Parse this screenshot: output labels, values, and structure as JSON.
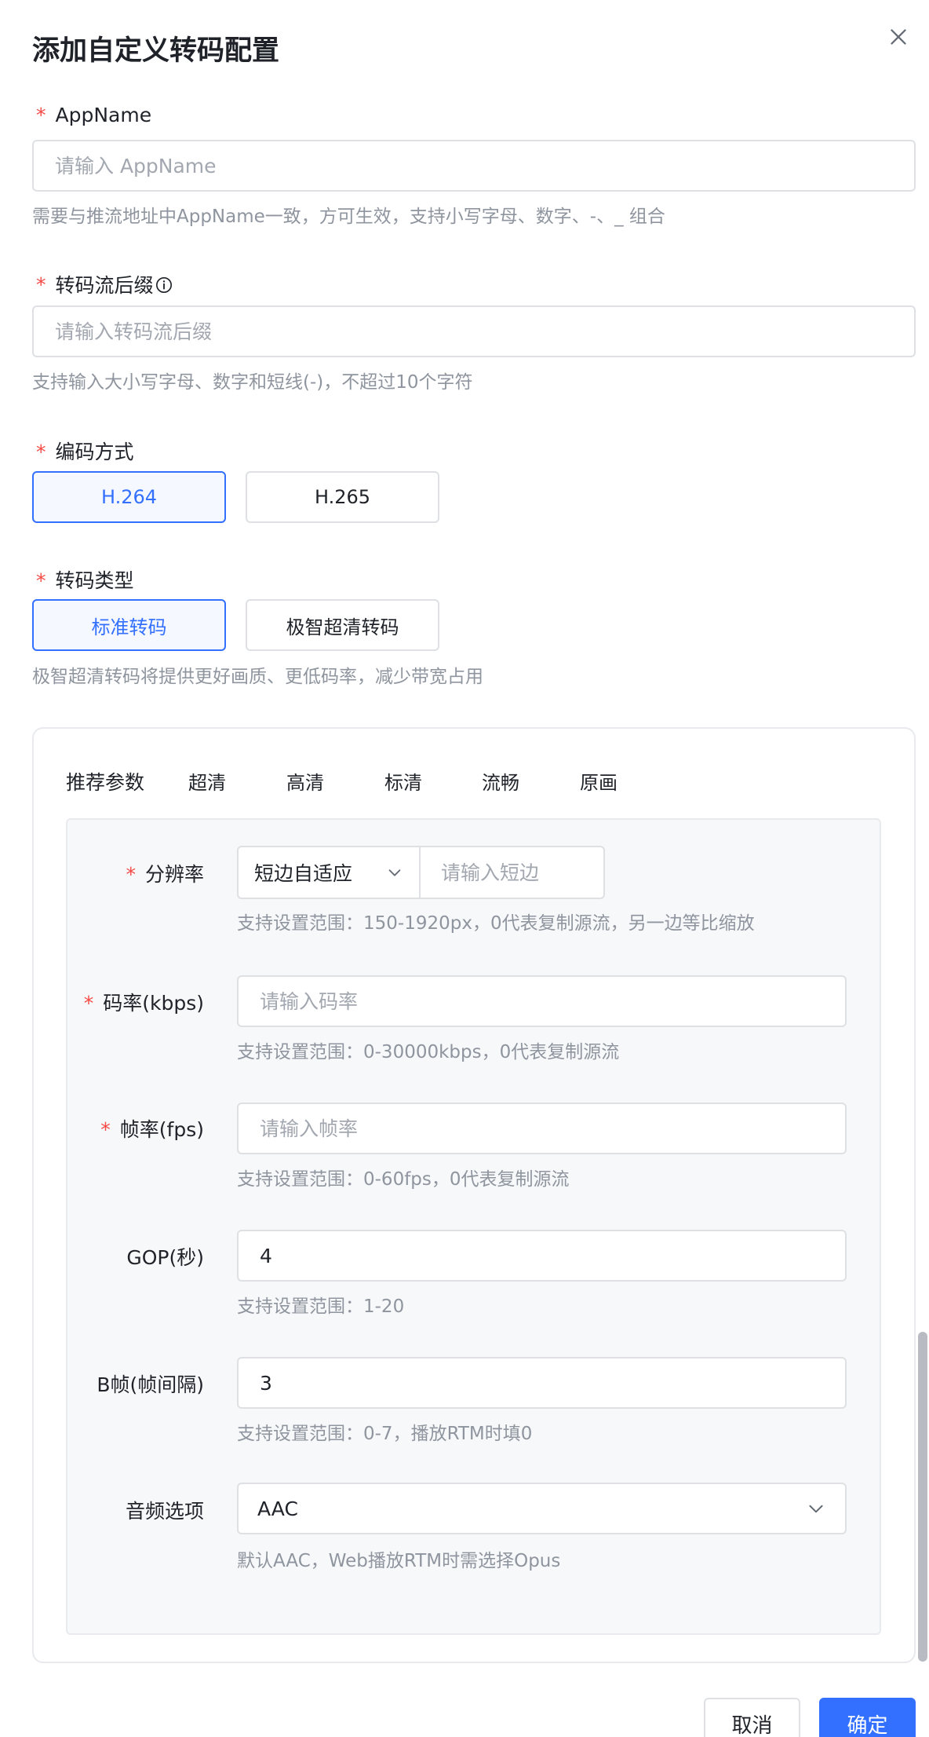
{
  "dialog": {
    "title": "添加自定义转码配置",
    "close_icon": "close-icon"
  },
  "appname": {
    "required": "*",
    "label": "AppName",
    "placeholder": "请输入 AppName",
    "hint": "需要与推流地址中AppName一致，方可生效，支持小写字母、数字、-、_ 组合"
  },
  "suffix": {
    "required": "*",
    "label": "转码流后缀",
    "info_icon": "info-circle-icon",
    "placeholder": "请输入转码流后缀",
    "hint": "支持输入大小写字母、数字和短线(-)，不超过10个字符"
  },
  "codec": {
    "required": "*",
    "label": "编码方式",
    "options": [
      "H.264",
      "H.265"
    ],
    "selected": "H.264"
  },
  "transcode_type": {
    "required": "*",
    "label": "转码类型",
    "options": [
      "标准转码",
      "极智超清转码"
    ],
    "selected": "标准转码",
    "hint": "极智超清转码将提供更好画质、更低码率，减少带宽占用"
  },
  "params": {
    "label": "推荐参数",
    "tabs": [
      "超清",
      "高清",
      "标清",
      "流畅",
      "原画"
    ],
    "resolution": {
      "required": "*",
      "label": "分辨率",
      "mode": "短边自适应",
      "placeholder": "请输入短边",
      "hint": "支持设置范围：150-1920px，0代表复制源流，另一边等比缩放"
    },
    "bitrate": {
      "required": "*",
      "label": "码率(kbps)",
      "placeholder": "请输入码率",
      "hint": "支持设置范围：0-30000kbps，0代表复制源流"
    },
    "fps": {
      "required": "*",
      "label": "帧率(fps)",
      "placeholder": "请输入帧率",
      "hint": "支持设置范围：0-60fps，0代表复制源流"
    },
    "gop": {
      "label": "GOP(秒)",
      "value": "4",
      "hint": "支持设置范围：1-20"
    },
    "bframes": {
      "label": "B帧(帧间隔)",
      "value": "3",
      "hint": "支持设置范围：0-7，播放RTM时填0"
    },
    "audio": {
      "label": "音频选项",
      "value": "AAC",
      "hint": "默认AAC，Web播放RTM时需选择Opus"
    }
  },
  "footer": {
    "cancel": "取消",
    "confirm": "确定"
  },
  "colors": {
    "primary": "#3370ff",
    "required": "#f54a45",
    "hint": "#8f959e"
  }
}
